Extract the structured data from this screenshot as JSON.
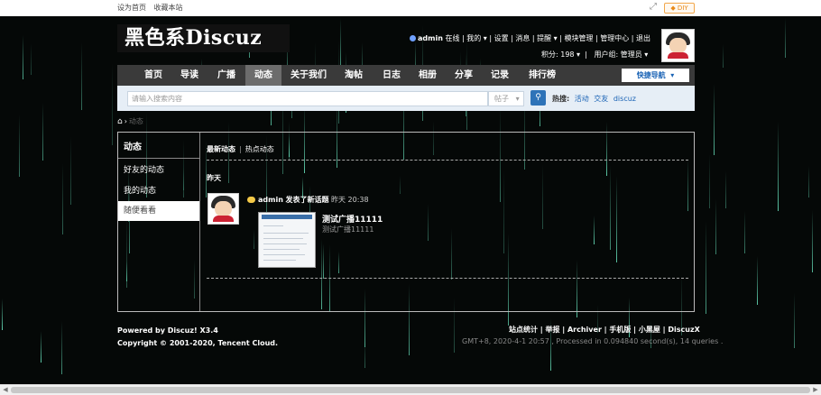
{
  "topbar": {
    "set_home": "设为首页",
    "bookmark": "收藏本站",
    "diy": "◆ DIY",
    "fullscreen_icon": "expand-icon"
  },
  "site": {
    "logo": "黑色系Discuz"
  },
  "user": {
    "name": "admin",
    "online": "在线",
    "my": "我的",
    "settings": "设置",
    "messages": "消息",
    "reminders": "提醒",
    "module_mgmt": "模块管理",
    "admin_center": "管理中心",
    "logout": "退出",
    "points": "积分: 198",
    "group": "用户组: 管理员"
  },
  "nav": {
    "items": [
      "首页",
      "导读",
      "广播",
      "动态",
      "关于我们",
      "淘帖",
      "日志",
      "相册",
      "分享",
      "记录",
      "排行榜"
    ],
    "active_index": 3,
    "quick_nav": "快捷导航"
  },
  "search": {
    "placeholder": "请输入搜索内容",
    "type": "帖子",
    "hot_label": "热搜:",
    "hot_terms": [
      "活动",
      "交友",
      "discuz"
    ]
  },
  "breadcrumb": {
    "current": "动态"
  },
  "sidebar": {
    "title": "动态",
    "items": [
      "好友的动态",
      "我的动态",
      "随便看看"
    ],
    "active_index": 2
  },
  "feed": {
    "tabs": [
      "最新动态",
      "热点动态"
    ],
    "day": "昨天",
    "entry": {
      "user": "admin",
      "action": "发表了新话题",
      "time": "昨天 20:38",
      "title": "测试广播11111",
      "summary": "测试广播11111"
    }
  },
  "footer": {
    "powered": "Powered by Discuz! X3.4",
    "copyright": "Copyright © 2001-2020, Tencent Cloud.",
    "links": "站点统计 | 举报 | Archiver | 手机版 | 小黑屋 | DiscuzX",
    "stats": "GMT+8, 2020-4-1 20:57 , Processed in 0.094840 second(s), 14 queries ."
  }
}
